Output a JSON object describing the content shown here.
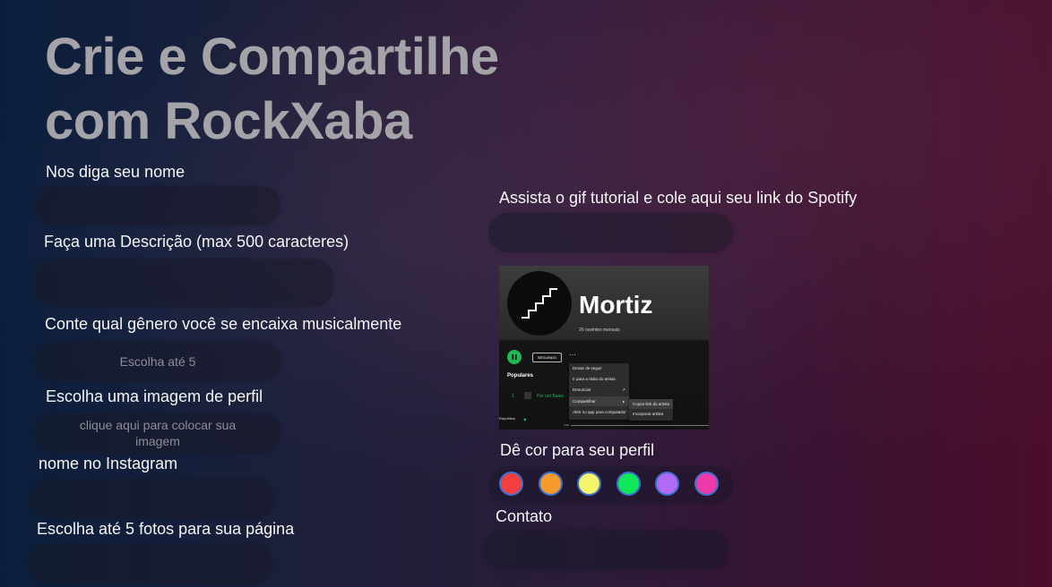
{
  "hero": {
    "title_line1": "Crie e Compartilhe",
    "title_line2": "com RockXaba"
  },
  "form": {
    "name_label": "Nos diga seu nome",
    "description_label": "Faça uma Descrição (max 500 caracteres)",
    "genre_label": "Conte qual gênero você se encaixa musicalmente",
    "genre_placeholder": "Escolha até 5",
    "profile_image_label": "Escolha uma imagem de perfil",
    "profile_image_placeholder": "clique aqui para colocar sua imagem",
    "instagram_label": "nome no Instagram",
    "photos_label": "Escolha até 5 fotos para sua página",
    "spotify_label": "Assista o gif tutorial e cole aqui seu link do Spotify",
    "color_label": "Dê cor para seu perfil",
    "contact_label": "Contato"
  },
  "spotify_gif": {
    "artist": "Mortiz",
    "listeners": "20 ouvintes mensais",
    "follow_button": "SEGUINDO",
    "dots": "···",
    "section": "Populares",
    "track_number": "1",
    "track_title": "Por um Baixo",
    "album": "República",
    "time": "0:00",
    "menu": [
      "Deixar de seguir",
      "Ir para a rádio do artista",
      "Denunciar",
      "Compartilhar",
      "Abrir no app para computador"
    ],
    "submenu": [
      "Copiar link do artista",
      "Incorporar artista"
    ]
  },
  "colors": [
    {
      "name": "red",
      "hex": "#f24040"
    },
    {
      "name": "orange",
      "hex": "#f59a2b"
    },
    {
      "name": "yellow",
      "hex": "#f4f56a"
    },
    {
      "name": "green",
      "hex": "#10e85a"
    },
    {
      "name": "purple",
      "hex": "#b06af5"
    },
    {
      "name": "pink",
      "hex": "#ec3aa8"
    }
  ]
}
